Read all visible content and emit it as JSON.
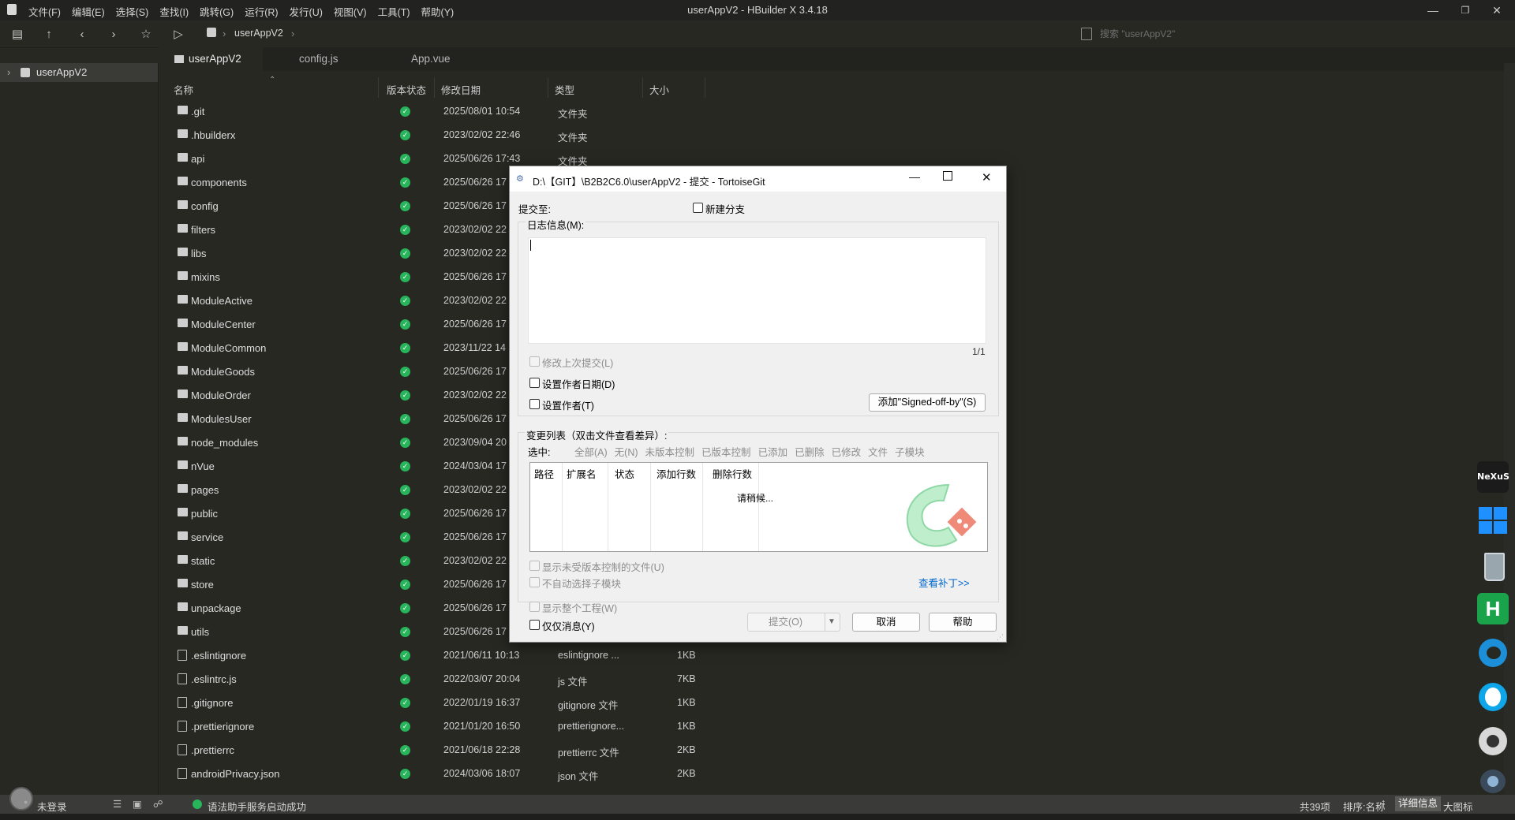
{
  "window": {
    "title": "userAppV2 - HBuilder X 3.4.18",
    "menu": [
      "文件(F)",
      "编辑(E)",
      "选择(S)",
      "查找(I)",
      "跳转(G)",
      "运行(R)",
      "发行(U)",
      "视图(V)",
      "工具(T)",
      "帮助(Y)"
    ]
  },
  "toolbar": {
    "breadcrumb": "userAppV2",
    "search_placeholder": "搜索 \"userAppV2\""
  },
  "sidebar": {
    "project": "userAppV2"
  },
  "tabs": [
    {
      "label": "userAppV2"
    },
    {
      "label": "config.js"
    },
    {
      "label": "App.vue"
    }
  ],
  "table": {
    "headers": [
      "名称",
      "版本状态",
      "修改日期",
      "类型",
      "大小"
    ],
    "rows": [
      {
        "name": ".git",
        "date": "2025/08/01 10:54",
        "type": "文件夹",
        "size": "",
        "kind": "folder"
      },
      {
        "name": ".hbuilderx",
        "date": "2023/02/02 22:46",
        "type": "文件夹",
        "size": "",
        "kind": "folder"
      },
      {
        "name": "api",
        "date": "2025/06/26 17:43",
        "type": "文件夹",
        "size": "",
        "kind": "folder"
      },
      {
        "name": "components",
        "date": "2025/06/26 17",
        "type": "",
        "size": "",
        "kind": "folder"
      },
      {
        "name": "config",
        "date": "2025/06/26 17",
        "type": "",
        "size": "",
        "kind": "folder"
      },
      {
        "name": "filters",
        "date": "2023/02/02 22",
        "type": "",
        "size": "",
        "kind": "folder"
      },
      {
        "name": "libs",
        "date": "2023/02/02 22",
        "type": "",
        "size": "",
        "kind": "folder"
      },
      {
        "name": "mixins",
        "date": "2025/06/26 17",
        "type": "",
        "size": "",
        "kind": "folder"
      },
      {
        "name": "ModuleActive",
        "date": "2023/02/02 22",
        "type": "",
        "size": "",
        "kind": "folder"
      },
      {
        "name": "ModuleCenter",
        "date": "2025/06/26 17",
        "type": "",
        "size": "",
        "kind": "folder"
      },
      {
        "name": "ModuleCommon",
        "date": "2023/11/22 14",
        "type": "",
        "size": "",
        "kind": "folder"
      },
      {
        "name": "ModuleGoods",
        "date": "2025/06/26 17",
        "type": "",
        "size": "",
        "kind": "folder"
      },
      {
        "name": "ModuleOrder",
        "date": "2023/02/02 22",
        "type": "",
        "size": "",
        "kind": "folder"
      },
      {
        "name": "ModulesUser",
        "date": "2025/06/26 17",
        "type": "",
        "size": "",
        "kind": "folder"
      },
      {
        "name": "node_modules",
        "date": "2023/09/04 20",
        "type": "",
        "size": "",
        "kind": "folder"
      },
      {
        "name": "nVue",
        "date": "2024/03/04 17",
        "type": "",
        "size": "",
        "kind": "folder"
      },
      {
        "name": "pages",
        "date": "2023/02/02 22",
        "type": "",
        "size": "",
        "kind": "folder"
      },
      {
        "name": "public",
        "date": "2025/06/26 17",
        "type": "",
        "size": "",
        "kind": "folder"
      },
      {
        "name": "service",
        "date": "2025/06/26 17",
        "type": "",
        "size": "",
        "kind": "folder"
      },
      {
        "name": "static",
        "date": "2023/02/02 22",
        "type": "",
        "size": "",
        "kind": "folder"
      },
      {
        "name": "store",
        "date": "2025/06/26 17",
        "type": "",
        "size": "",
        "kind": "folder"
      },
      {
        "name": "unpackage",
        "date": "2025/06/26 17",
        "type": "",
        "size": "",
        "kind": "folder"
      },
      {
        "name": "utils",
        "date": "2025/06/26 17",
        "type": "",
        "size": "",
        "kind": "folder"
      },
      {
        "name": ".eslintignore",
        "date": "2021/06/11 10:13",
        "type": "eslintignore ...",
        "size": "1KB",
        "kind": "file"
      },
      {
        "name": ".eslintrc.js",
        "date": "2022/03/07 20:04",
        "type": "js 文件",
        "size": "7KB",
        "kind": "file"
      },
      {
        "name": ".gitignore",
        "date": "2022/01/19 16:37",
        "type": "gitignore 文件",
        "size": "1KB",
        "kind": "file"
      },
      {
        "name": ".prettierignore",
        "date": "2021/01/20 16:50",
        "type": "prettierignore...",
        "size": "1KB",
        "kind": "file"
      },
      {
        "name": ".prettierrc",
        "date": "2021/06/18 22:28",
        "type": "prettierrc 文件",
        "size": "2KB",
        "kind": "file"
      },
      {
        "name": "androidPrivacy.json",
        "date": "2024/03/06 18:07",
        "type": "json 文件",
        "size": "2KB",
        "kind": "json"
      }
    ]
  },
  "dialog": {
    "title": "D:\\【GIT】\\B2B2C6.0\\userAppV2 - 提交 - TortoiseGit",
    "commit_to": "提交至:",
    "new_branch": "新建分支",
    "log_label": "日志信息(M):",
    "counter": "1/1",
    "amend": "修改上次提交(L)",
    "set_date": "设置作者日期(D)",
    "set_author": "设置作者(T)",
    "signoff": "添加\"Signed-off-by\"(S)",
    "changes_label": "变更列表（双击文件查看差异）:",
    "select_label": "选中:",
    "filters": [
      "全部(A)",
      "无(N)",
      "未版本控制",
      "已版本控制",
      "已添加",
      "已删除",
      "已修改",
      "文件",
      "子模块"
    ],
    "columns": [
      "路径",
      "扩展名",
      "状态",
      "添加行数",
      "删除行数"
    ],
    "loading": "请稍候...",
    "show_unversioned": "显示未受版本控制的文件(U)",
    "no_autoselect": "不自动选择子模块",
    "view_patch": "查看补丁>>",
    "show_whole": "显示整个工程(W)",
    "msg_only": "仅仅消息(Y)",
    "btn_commit": "提交(O)",
    "btn_cancel": "取消",
    "btn_help": "帮助"
  },
  "dock": [
    {
      "name": "nexus-icon",
      "label": "NeXuS"
    },
    {
      "name": "windows-icon"
    },
    {
      "name": "recycle-bin-icon"
    },
    {
      "name": "hbuilder-icon",
      "label": "H"
    },
    {
      "name": "edge-icon"
    },
    {
      "name": "qq-icon"
    },
    {
      "name": "disk-icon"
    },
    {
      "name": "camera-icon"
    }
  ],
  "status": {
    "login": "未登录",
    "assistant": "语法助手服务启动成功",
    "count": "共39项",
    "sort": "排序:名称",
    "detail": "详细信息",
    "bigicon": "大图标"
  },
  "colors": {
    "ok_green": "#27b45b",
    "link_blue": "#0066cc",
    "background": "#272822"
  }
}
